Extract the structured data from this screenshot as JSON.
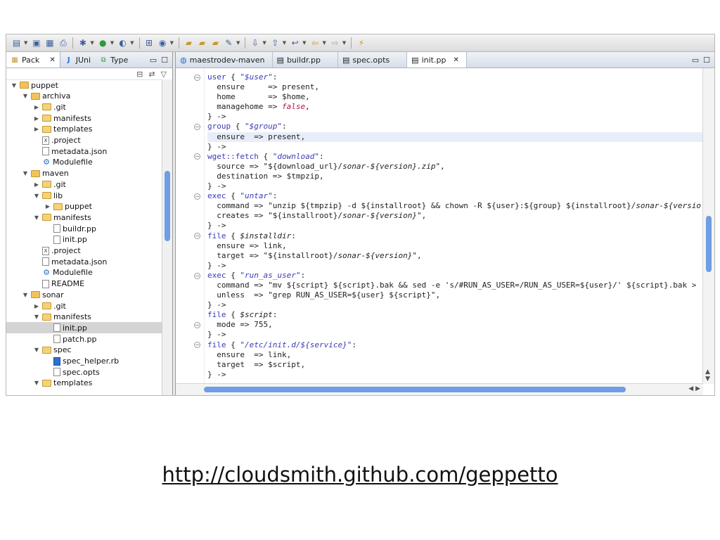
{
  "caption": "http://cloudsmith.github.com/geppetto",
  "left_panel": {
    "tabs": [
      {
        "label": "Pack",
        "icon": "package-explorer-icon",
        "close": "✕"
      },
      {
        "label": "JUni",
        "icon": "junit-icon"
      },
      {
        "label": "Type",
        "icon": "type-hierarchy-icon"
      }
    ],
    "tree": [
      {
        "label": "puppet",
        "type": "project",
        "expanded": true,
        "depth": 0
      },
      {
        "label": "archiva",
        "type": "project",
        "expanded": true,
        "depth": 1
      },
      {
        "label": ".git",
        "type": "folder",
        "expanded": false,
        "depth": 2
      },
      {
        "label": "manifests",
        "type": "folder",
        "expanded": false,
        "depth": 2
      },
      {
        "label": "templates",
        "type": "folder",
        "expanded": false,
        "depth": 2
      },
      {
        "label": ".project",
        "type": "xfile",
        "depth": 2
      },
      {
        "label": "metadata.json",
        "type": "file",
        "depth": 2
      },
      {
        "label": "Modulefile",
        "type": "gear",
        "depth": 2
      },
      {
        "label": "maven",
        "type": "project",
        "expanded": true,
        "depth": 1
      },
      {
        "label": ".git",
        "type": "folder",
        "expanded": false,
        "depth": 2
      },
      {
        "label": "lib",
        "type": "folder",
        "expanded": true,
        "depth": 2
      },
      {
        "label": "puppet",
        "type": "folder",
        "expanded": false,
        "depth": 3
      },
      {
        "label": "manifests",
        "type": "folder",
        "expanded": true,
        "depth": 2
      },
      {
        "label": "buildr.pp",
        "type": "file",
        "depth": 3
      },
      {
        "label": "init.pp",
        "type": "file",
        "depth": 3
      },
      {
        "label": ".project",
        "type": "xfile",
        "depth": 2
      },
      {
        "label": "metadata.json",
        "type": "file",
        "depth": 2
      },
      {
        "label": "Modulefile",
        "type": "gear",
        "depth": 2
      },
      {
        "label": "README",
        "type": "file",
        "depth": 2
      },
      {
        "label": "sonar",
        "type": "project",
        "expanded": true,
        "depth": 1
      },
      {
        "label": ".git",
        "type": "folder",
        "expanded": false,
        "depth": 2
      },
      {
        "label": "manifests",
        "type": "folder",
        "expanded": true,
        "depth": 2
      },
      {
        "label": "init.pp",
        "type": "file",
        "depth": 3,
        "selected": true
      },
      {
        "label": "patch.pp",
        "type": "file",
        "depth": 3
      },
      {
        "label": "spec",
        "type": "folder",
        "expanded": true,
        "depth": 2
      },
      {
        "label": "spec_helper.rb",
        "type": "rbfile",
        "depth": 3
      },
      {
        "label": "spec.opts",
        "type": "file",
        "depth": 3
      },
      {
        "label": "templates",
        "type": "folder",
        "expanded": true,
        "depth": 2
      }
    ]
  },
  "editor": {
    "tabs": [
      {
        "label": "maestrodev-maven",
        "active": false
      },
      {
        "label": "buildr.pp",
        "active": false
      },
      {
        "label": "spec.opts",
        "active": false
      },
      {
        "label": "init.pp",
        "active": true,
        "close": "✕"
      }
    ],
    "fold_lines": [
      0,
      5,
      8,
      12,
      16,
      20,
      25,
      27
    ]
  },
  "colors": {
    "keyword": "#3a3ab8",
    "boolean": "#b5124e",
    "selection": "#d4d4d4",
    "scroll_thumb": "#6e9ee3"
  }
}
